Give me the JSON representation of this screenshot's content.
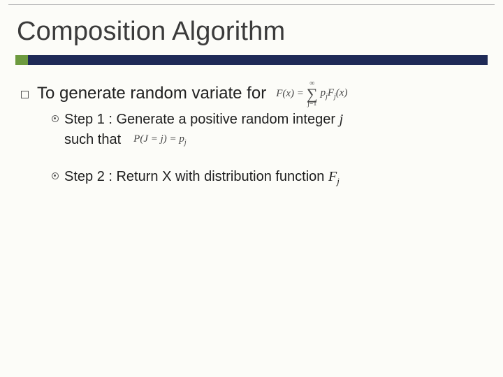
{
  "title": "Composition Algorithm",
  "l1_text": "To generate random variate for",
  "math_sum": {
    "Fx": "F(x) =",
    "upper": "∞",
    "lower": "j=1",
    "term_p": "p",
    "term_F": "F",
    "term_arg": "(x)"
  },
  "steps": {
    "s1_line": "Step 1 : Generate a positive random integer",
    "s1_var": "j",
    "s1_such": "such that",
    "s1_math": {
      "lhs": "P(J = j) = p",
      "sub": "j"
    },
    "s2_line": "Step 2 : Return X with distribution function",
    "s2_F": "F",
    "s2_sub": "j"
  }
}
